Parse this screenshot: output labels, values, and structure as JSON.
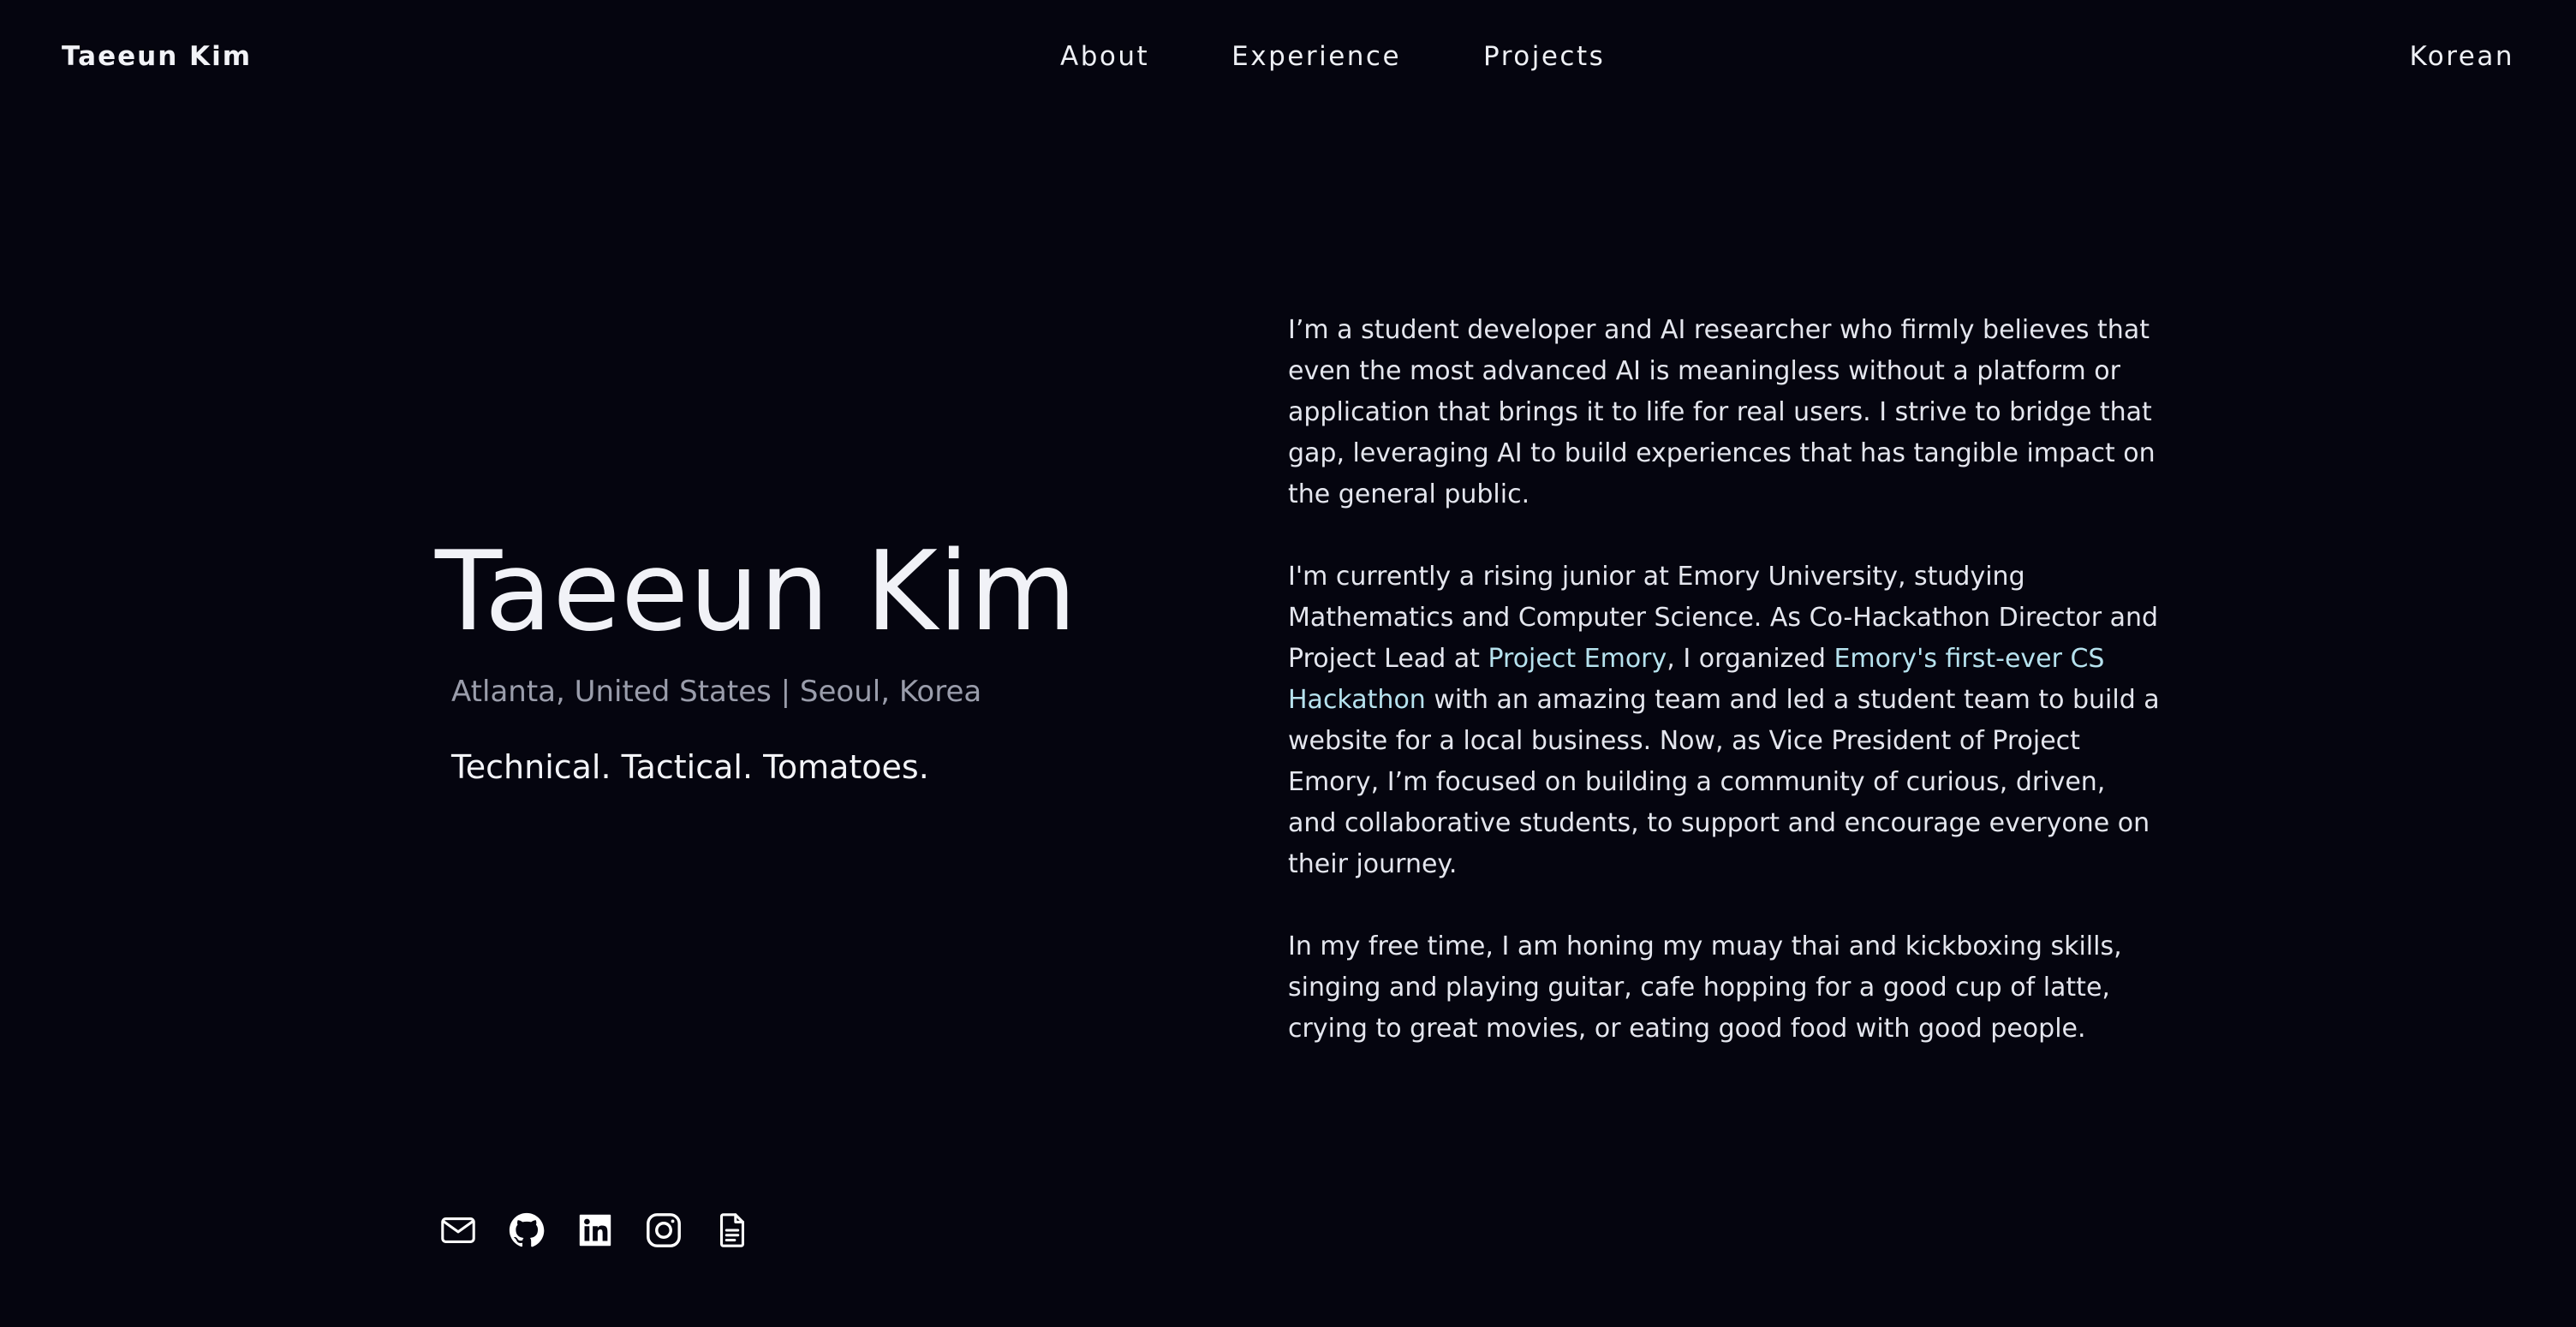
{
  "nav": {
    "brand": "Taeeun Kim",
    "links": [
      {
        "label": "About"
      },
      {
        "label": "Experience"
      },
      {
        "label": "Projects"
      }
    ],
    "language_toggle": "Korean"
  },
  "hero": {
    "name": "Taeeun Kim",
    "location": "Atlanta, United States | Seoul, Korea",
    "tagline": "Technical. Tactical. Tomatoes."
  },
  "about": {
    "p1": "I’m a student developer and AI researcher who firmly believes that even the most advanced AI is meaningless without a platform or application that brings it to life for real users. I strive to bridge that gap, leveraging AI to build experiences that has tangible impact on the general public.",
    "p2_a": "I'm currently a rising junior at Emory University, studying Mathematics and Computer Science. As Co-Hackathon Director and Project Lead at ",
    "p2_link1": "Project Emory",
    "p2_b": ", I organized ",
    "p2_link2": "Emory's first-ever CS Hackathon",
    "p2_c": " with an amazing team and led a student team to build a website for a local business. Now, as Vice President of Project Emory, I’m focused on building a community of curious, driven, and collaborative students, to support and encourage everyone on their journey.",
    "p3": "In my free time, I am honing my muay thai and kickboxing skills, singing and playing guitar, cafe hopping for a good cup of latte, crying to great movies, or eating good food with good people."
  },
  "socials": [
    {
      "icon": "mail-icon"
    },
    {
      "icon": "github-icon"
    },
    {
      "icon": "linkedin-icon"
    },
    {
      "icon": "instagram-icon"
    },
    {
      "icon": "resume-document-icon"
    }
  ],
  "colors": {
    "background": "#05050f",
    "text": "#e6e8ef",
    "muted": "#9a9dab",
    "link_accent": "#b6e2ee"
  }
}
